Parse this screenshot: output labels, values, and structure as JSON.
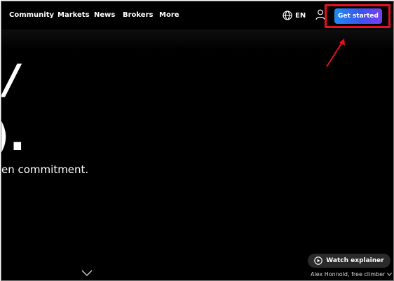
{
  "nav": {
    "items": [
      {
        "label": "Community"
      },
      {
        "label": "Markets"
      },
      {
        "label": "News"
      },
      {
        "label": "Brokers"
      },
      {
        "label": "More"
      }
    ],
    "language": {
      "label": "EN",
      "icon": "globe-icon"
    },
    "user_icon": "user-icon",
    "cta": {
      "label": "Get started",
      "highlighted": true
    }
  },
  "hero": {
    "line1": "/",
    "line2": ").",
    "subtitle": "en commitment."
  },
  "footer": {
    "scroll_icon": "chevron-down-icon",
    "watch_label": "Watch explainer",
    "watch_icon": "play-icon",
    "credit": "Alex Honnold, free climber"
  },
  "colors": {
    "background": "#000000",
    "text": "#ffffff",
    "cta_gradient_start": "#1f8bf5",
    "cta_gradient_end": "#7a3df0",
    "annotation": "#e8101f",
    "pill": "#2a2a2a"
  }
}
